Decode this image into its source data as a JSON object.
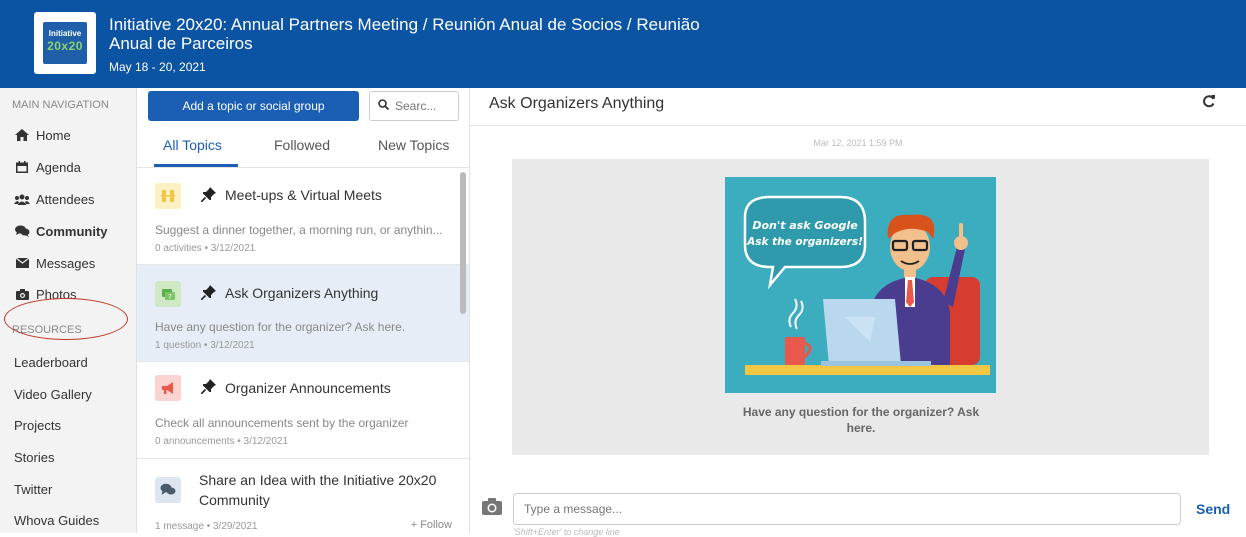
{
  "header": {
    "logo_line1": "Initiative",
    "logo_line2": "20x20",
    "title": "Initiative 20x20: Annual Partners Meeting / Reunión Anual de Socios / Reunião Anual de Parceiros",
    "date": "May 18 - 20, 2021",
    "background": "#0b53a3"
  },
  "sidebar": {
    "main_nav_label": "MAIN NAVIGATION",
    "nav_items": [
      {
        "label": "Home",
        "icon": "home-icon"
      },
      {
        "label": "Agenda",
        "icon": "calendar-icon"
      },
      {
        "label": "Attendees",
        "icon": "users-icon"
      },
      {
        "label": "Community",
        "icon": "chat-icon",
        "active": true
      },
      {
        "label": "Messages",
        "icon": "envelope-icon"
      },
      {
        "label": "Photos",
        "icon": "camera-icon"
      }
    ],
    "resources_label": "RESOURCES",
    "resource_items": [
      "Leaderboard",
      "Video Gallery",
      "Projects",
      "Stories",
      "Twitter",
      "Whova Guides"
    ]
  },
  "topics": {
    "add_button": "Add a topic or social group",
    "search_placeholder": "Searc...",
    "tabs": [
      "All Topics",
      "Followed",
      "New Topics"
    ],
    "active_tab": 0,
    "items": [
      {
        "title": "Meet-ups & Virtual Meets",
        "desc": "Suggest a dinner together, a morning run, or anythin...",
        "meta": "0 activities • 3/12/2021",
        "pinned": true,
        "icon": "meetup-icon"
      },
      {
        "title": "Ask Organizers Anything",
        "desc": "Have any question for the organizer? Ask here.",
        "meta": "1 question • 3/12/2021",
        "pinned": true,
        "icon": "question-icon",
        "selected": true
      },
      {
        "title": "Organizer Announcements",
        "desc": "Check all announcements sent by the organizer",
        "meta": "0 announcements • 3/12/2021",
        "pinned": true,
        "icon": "megaphone-icon"
      },
      {
        "title_line1": "Share an Idea with the Initiative 20x20",
        "title_line2": "Community",
        "meta": "1 message • 3/29/2021",
        "follow": "+ Follow",
        "icon": "chat-bubble-icon"
      }
    ]
  },
  "chat": {
    "title": "Ask Organizers Anything",
    "timestamp": "Mar 12, 2021 1:59 PM",
    "bubble_line1": "Don't ask Google",
    "bubble_line2": "Ask the organizers!",
    "caption": "Have any question for the organizer? Ask here.",
    "input_placeholder": "Type a message...",
    "send_label": "Send",
    "hint": "'Shift+Enter' to change line"
  },
  "colors": {
    "accent": "#1a5fb4",
    "highlight_circle": "#c0392b",
    "image_bg": "#3badbf"
  }
}
